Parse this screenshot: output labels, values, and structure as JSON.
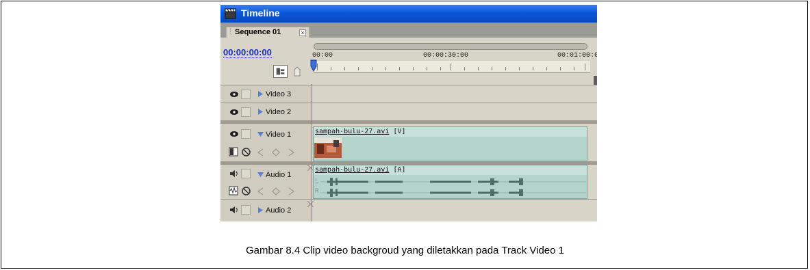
{
  "window": {
    "title": "Timeline"
  },
  "tab": {
    "label": "Sequence 01",
    "close": "×"
  },
  "timecode": "00:00:00:00",
  "ruler": {
    "labels": [
      "00:00",
      "00:00:30:00",
      "00:01:00:0"
    ]
  },
  "tracks": {
    "video3": {
      "name": "Video 3"
    },
    "video2": {
      "name": "Video 2"
    },
    "video1": {
      "name": "Video 1",
      "clip_name": "sampah-bulu-27.avi",
      "clip_suffix": "[V]"
    },
    "audio1": {
      "name": "Audio 1",
      "clip_name": "sampah-bulu-27.avi",
      "clip_suffix": "[A]",
      "channel_left": "L",
      "channel_right": "R"
    },
    "audio2": {
      "name": "Audio 2"
    }
  },
  "caption": "Gambar 8.4 Clip video backgroud yang diletakkan pada Track Video 1",
  "colors": {
    "titlebar": "#0a57d9",
    "timecode": "#1a2fb8",
    "playhead": "#e8612a",
    "clip": "#b4d4cb"
  }
}
